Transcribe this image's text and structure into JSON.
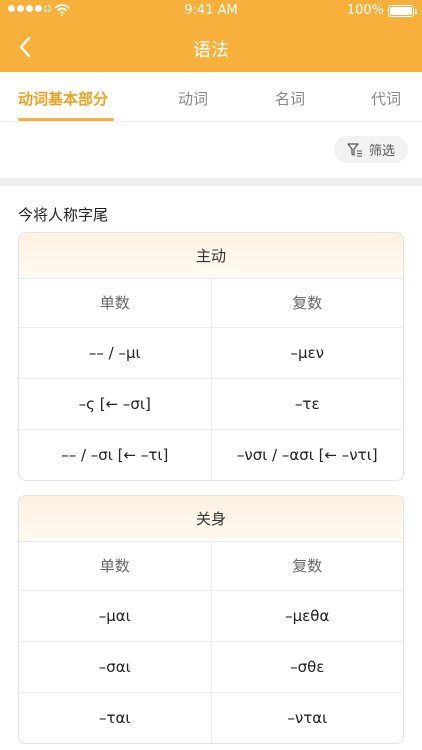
{
  "status": {
    "time": "9:41 AM",
    "battery": "100%"
  },
  "header": {
    "title": "语法"
  },
  "tabs": [
    "动词基本部分",
    "动词",
    "名词",
    "代词"
  ],
  "filter": {
    "label": "筛选"
  },
  "section": {
    "title": "今将人称字尾"
  },
  "tables": [
    {
      "title": "主动",
      "headers": [
        "单数",
        "复数"
      ],
      "rows": [
        [
          "–– / –μι",
          "–μεν"
        ],
        [
          "–ς [← –σι]",
          "–τε"
        ],
        [
          "–– / –σι [← –τι]",
          "–νσι / –ασι [← –ντι]"
        ]
      ]
    },
    {
      "title": "关身",
      "headers": [
        "单数",
        "复数"
      ],
      "rows": [
        [
          "–μαι",
          "–μεθα"
        ],
        [
          "–σαι",
          "–σθε"
        ],
        [
          "–ται",
          "–νται"
        ]
      ]
    }
  ]
}
